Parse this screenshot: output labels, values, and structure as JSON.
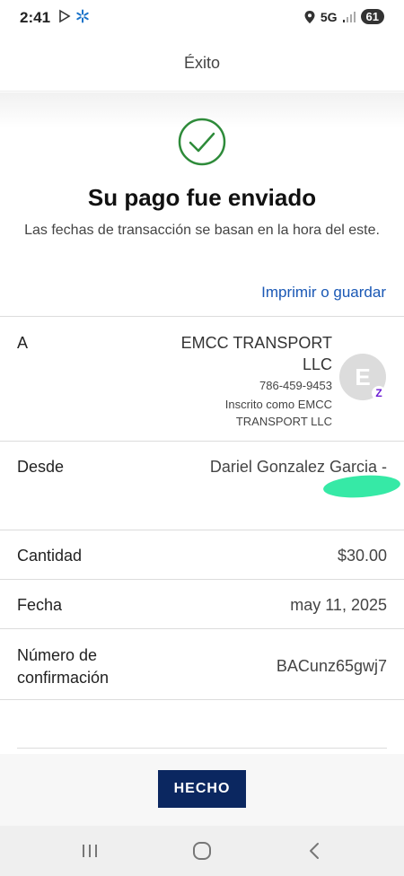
{
  "status_bar": {
    "time": "2:41",
    "network": "5G",
    "battery": "61"
  },
  "header": {
    "title": "Éxito"
  },
  "confirmation": {
    "title": "Su pago fue enviado",
    "subtitle": "Las fechas de transacción se basan en la hora del este.",
    "print_link": "Imprimir o guardar"
  },
  "details": {
    "to": {
      "label": "A",
      "name_line1": "EMCC TRANSPORT",
      "name_line2": "LLC",
      "phone": "786-459-9453",
      "registered_line1": "Inscrito como EMCC",
      "registered_line2": "TRANSPORT LLC",
      "avatar_initial": "E",
      "badge_symbol": "Z"
    },
    "from": {
      "label": "Desde",
      "value": "Dariel Gonzalez Garcia -"
    },
    "amount": {
      "label": "Cantidad",
      "value": "$30.00"
    },
    "date": {
      "label": "Fecha",
      "value": "may 11, 2025"
    },
    "confirmation_number": {
      "label_line1": "Número de",
      "label_line2": "confirmación",
      "value": "BACunz65gwj7"
    }
  },
  "footer": {
    "done_label": "HECHO"
  },
  "colors": {
    "success_green": "#2e8b3a",
    "link_blue": "#1a58b5",
    "button_navy": "#0b2760",
    "zelle_purple": "#6d1ed4",
    "highlight": "#36e9a6"
  }
}
